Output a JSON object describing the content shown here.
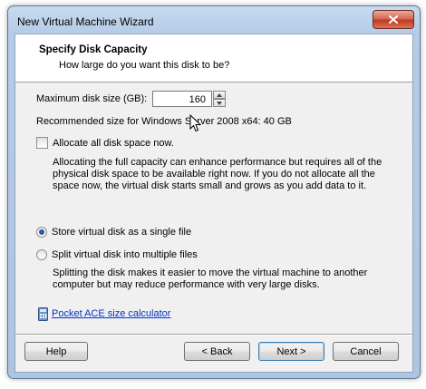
{
  "window": {
    "title": "New Virtual Machine Wizard"
  },
  "header": {
    "title": "Specify Disk Capacity",
    "subtitle": "How large do you want this disk to be?"
  },
  "disk_size": {
    "label": "Maximum disk size (GB):",
    "value": "160"
  },
  "recommended": "Recommended size for Windows Server 2008 x64: 40 GB",
  "allocate": {
    "label": "Allocate all disk space now.",
    "checked": false,
    "description_lines": [
      "Allocating the full capacity can enhance performance but requires all of the",
      "physical disk space to be available right now. If you do not allocate all the",
      "space now, the virtual disk starts small and grows as you add data to it."
    ]
  },
  "storage_options": [
    {
      "label": "Store virtual disk as a single file",
      "selected": true
    },
    {
      "label": "Split virtual disk into multiple files",
      "selected": false
    }
  ],
  "split_description_lines": [
    "Splitting the disk makes it easier to move the virtual machine to another",
    "computer but may reduce performance with very large disks."
  ],
  "link": {
    "label": "Pocket ACE size calculator",
    "icon": "calculator-icon"
  },
  "buttons": {
    "help": "Help",
    "back": "< Back",
    "next": "Next >",
    "cancel": "Cancel"
  },
  "colors": {
    "link": "#0033cc",
    "close_button": "#c2391e",
    "frame": "#b5cbe6"
  }
}
